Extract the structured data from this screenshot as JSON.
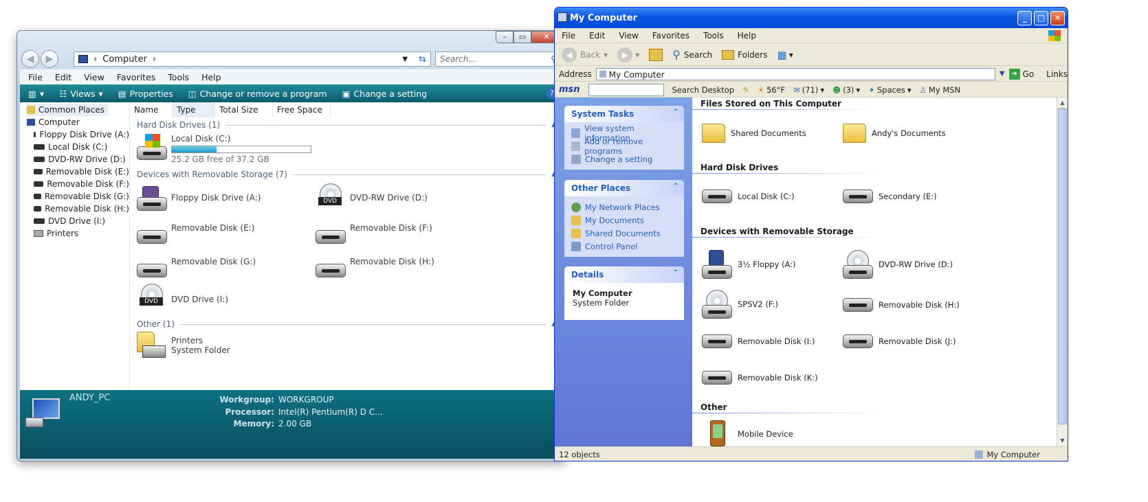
{
  "vista": {
    "search_placeholder": "Search...",
    "address": "Computer",
    "menu": [
      "File",
      "Edit",
      "View",
      "Favorites",
      "Tools",
      "Help"
    ],
    "commands": {
      "views": "Views",
      "properties": "Properties",
      "change_program": "Change or remove a program",
      "change_setting": "Change a setting"
    },
    "sidebar": [
      "Common Places",
      "Computer",
      "Floppy Disk Drive (A:)",
      "Local Disk (C:)",
      "DVD-RW Drive (D:)",
      "Removable Disk (E:)",
      "Removable Disk (F:)",
      "Removable Disk (G:)",
      "Removable Disk (H:)",
      "DVD Drive (I:)",
      "Printers"
    ],
    "columns": [
      "Name",
      "Type",
      "Total Size",
      "Free Space"
    ],
    "groups": {
      "hdd": "Hard Disk Drives (1)",
      "removable": "Devices with Removable Storage (7)",
      "other": "Other (1)"
    },
    "local_disk": {
      "name": "Local Disk (C:)",
      "free": "25.2 GB free of 37.2 GB",
      "used_fraction": 0.32
    },
    "removable": [
      "Floppy Disk Drive (A:)",
      "DVD-RW Drive (D:)",
      "Removable Disk (E:)",
      "Removable Disk (F:)",
      "Removable Disk (G:)",
      "Removable Disk (H:)",
      "DVD Drive (I:)"
    ],
    "printers": {
      "name": "Printers",
      "sub": "System Folder"
    },
    "details": {
      "pc_name": "ANDY_PC",
      "workgroup_label": "Workgroup:",
      "workgroup": "WORKGROUP",
      "processor_label": "Processor:",
      "processor": "Intel(R) Pentium(R) D C...",
      "memory_label": "Memory:",
      "memory": "2.00 GB"
    },
    "dvd_label": "DVD"
  },
  "xp": {
    "title": "My Computer",
    "menu": [
      "File",
      "Edit",
      "View",
      "Favorites",
      "Tools",
      "Help"
    ],
    "toolbar": {
      "back": "Back",
      "search": "Search",
      "folders": "Folders"
    },
    "address_label": "Address",
    "address": "My Computer",
    "go": "Go",
    "links": "Links",
    "msn": {
      "logo": "msn",
      "search_desktop": "Search Desktop",
      "weather": "56°F",
      "mail": "(71)",
      "contacts": "(3)",
      "spaces": "Spaces",
      "my_msn": "My MSN"
    },
    "system_tasks": {
      "title": "System Tasks",
      "items": [
        "View system information",
        "Add or remove programs",
        "Change a setting"
      ]
    },
    "other_places": {
      "title": "Other Places",
      "items": [
        "My Network Places",
        "My Documents",
        "Shared Documents",
        "Control Panel"
      ]
    },
    "details": {
      "title": "Details",
      "name": "My Computer",
      "sub": "System Folder"
    },
    "sections": {
      "files": "Files Stored on This Computer",
      "hdd": "Hard Disk Drives",
      "removable": "Devices with Removable Storage",
      "other": "Other"
    },
    "files": [
      "Shared Documents",
      "Andy's Documents"
    ],
    "hdd": [
      "Local Disk (C:)",
      "Secondary (E:)"
    ],
    "removable": [
      "3½ Floppy (A:)",
      "DVD-RW Drive (D:)",
      "SPSV2 (F:)",
      "Removable Disk (H:)",
      "Removable Disk (I:)",
      "Removable Disk (J:)",
      "Removable Disk (K:)"
    ],
    "other": [
      "Mobile Device"
    ],
    "status": "12 objects",
    "status_right": "My Computer"
  }
}
